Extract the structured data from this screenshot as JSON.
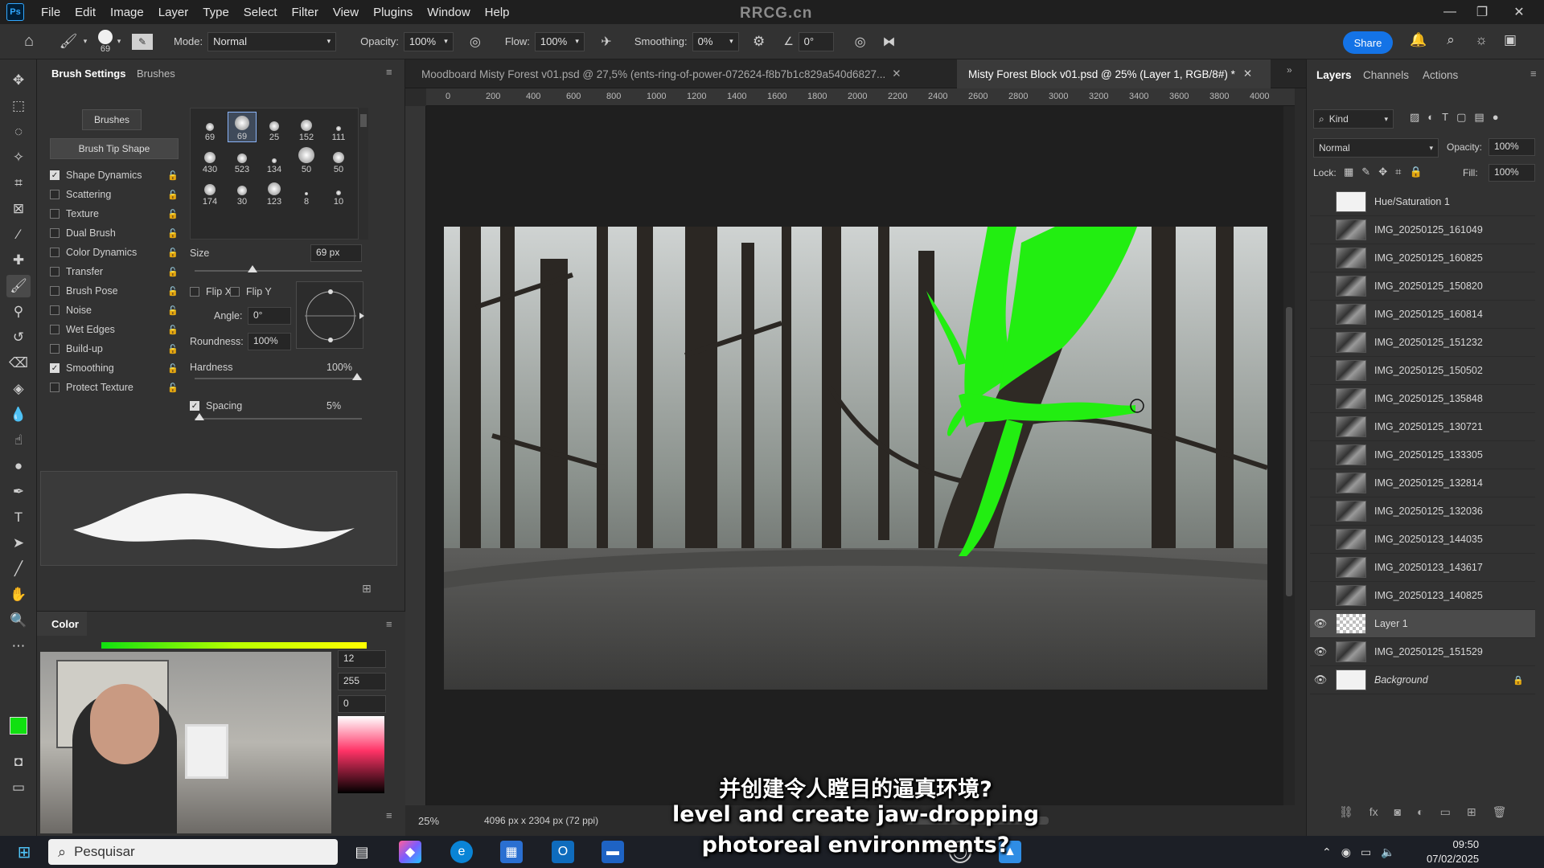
{
  "watermark": "RRCG.cn",
  "menu": [
    "File",
    "Edit",
    "Image",
    "Layer",
    "Type",
    "Select",
    "Filter",
    "View",
    "Plugins",
    "Window",
    "Help"
  ],
  "options": {
    "brush_size": "69",
    "mode_label": "Mode:",
    "mode_value": "Normal",
    "opacity_label": "Opacity:",
    "opacity_value": "100%",
    "flow_label": "Flow:",
    "flow_value": "100%",
    "smoothing_label": "Smoothing:",
    "smoothing_value": "0%",
    "angle_value": "0°",
    "share_label": "Share"
  },
  "brush_panel": {
    "tab_settings": "Brush Settings",
    "tab_brushes": "Brushes",
    "brushes_button": "Brushes",
    "tip_shape_button": "Brush Tip Shape",
    "options": [
      {
        "label": "Shape Dynamics",
        "checked": "✓"
      },
      {
        "label": "Scattering",
        "checked": ""
      },
      {
        "label": "Texture",
        "checked": ""
      },
      {
        "label": "Dual Brush",
        "checked": ""
      },
      {
        "label": "Color Dynamics",
        "checked": ""
      },
      {
        "label": "Transfer",
        "checked": ""
      },
      {
        "label": "Brush Pose",
        "checked": ""
      },
      {
        "label": "Noise",
        "checked": ""
      },
      {
        "label": "Wet Edges",
        "checked": ""
      },
      {
        "label": "Build-up",
        "checked": ""
      },
      {
        "label": "Smoothing",
        "checked": "✓"
      },
      {
        "label": "Protect Texture",
        "checked": ""
      }
    ],
    "tips": [
      "69",
      "69",
      "25",
      "152",
      "111",
      "430",
      "523",
      "134",
      "50",
      "50",
      "174",
      "30",
      "123",
      "8",
      "10"
    ],
    "size_label": "Size",
    "size_value": "69 px",
    "flip_x": "Flip X",
    "flip_y": "Flip Y",
    "angle_label": "Angle:",
    "angle_value": "0°",
    "roundness_label": "Roundness:",
    "roundness_value": "100%",
    "hardness_label": "Hardness",
    "hardness_value": "100%",
    "spacing_label": "Spacing",
    "spacing_value": "5%"
  },
  "color_panel": {
    "title": "Color",
    "r_value": "12",
    "g_value": "255",
    "b_value": "0",
    "foreground_color": "#10e010",
    "background_color": "#ffffff"
  },
  "documents": {
    "tab1": "Moodboard Misty Forest v01.psd @ 27,5% (ents-ring-of-power-072624-f8b7b1c829a540d6827...",
    "tab2": "Misty Forest Block v01.psd @ 25% (Layer 1, RGB/8#) *",
    "ruler_ticks": [
      "0",
      "200",
      "400",
      "600",
      "800",
      "1000",
      "1200",
      "1400",
      "1600",
      "1800",
      "2000",
      "2200",
      "2400",
      "2600",
      "2800",
      "3000",
      "3200",
      "3400",
      "3600",
      "3800",
      "4000"
    ],
    "zoom": "25%",
    "doc_info": "4096 px x 2304 px (72 ppi)"
  },
  "layers_panel": {
    "tabs": [
      "Layers",
      "Channels",
      "Actions"
    ],
    "kind": "Kind",
    "blend_mode": "Normal",
    "opacity_label": "Opacity:",
    "opacity_value": "100%",
    "lock_label": "Lock:",
    "fill_label": "Fill:",
    "fill_value": "100%",
    "layers": [
      {
        "name": "Hue/Saturation 1",
        "visible": false
      },
      {
        "name": "IMG_20250125_161049",
        "visible": false
      },
      {
        "name": "IMG_20250125_160825",
        "visible": false
      },
      {
        "name": "IMG_20250125_150820",
        "visible": false
      },
      {
        "name": "IMG_20250125_160814",
        "visible": false
      },
      {
        "name": "IMG_20250125_151232",
        "visible": false
      },
      {
        "name": "IMG_20250125_150502",
        "visible": false
      },
      {
        "name": "IMG_20250125_135848",
        "visible": false
      },
      {
        "name": "IMG_20250125_130721",
        "visible": false
      },
      {
        "name": "IMG_20250125_133305",
        "visible": false
      },
      {
        "name": "IMG_20250125_132814",
        "visible": false
      },
      {
        "name": "IMG_20250125_132036",
        "visible": false
      },
      {
        "name": "IMG_20250123_144035",
        "visible": false
      },
      {
        "name": "IMG_20250123_143617",
        "visible": false
      },
      {
        "name": "IMG_20250123_140825",
        "visible": false
      },
      {
        "name": "Layer 1",
        "visible": true
      },
      {
        "name": "IMG_20250125_151529",
        "visible": true
      },
      {
        "name": "Background",
        "visible": true
      }
    ]
  },
  "subtitles": {
    "line_cn": "并创建令人瞠目的逼真环境?",
    "line_en1": "level and create jaw-dropping",
    "line_en2": "photoreal environments?"
  },
  "taskbar": {
    "search_placeholder": "Pesquisar",
    "time": "09:50",
    "date": "07/02/2025"
  }
}
